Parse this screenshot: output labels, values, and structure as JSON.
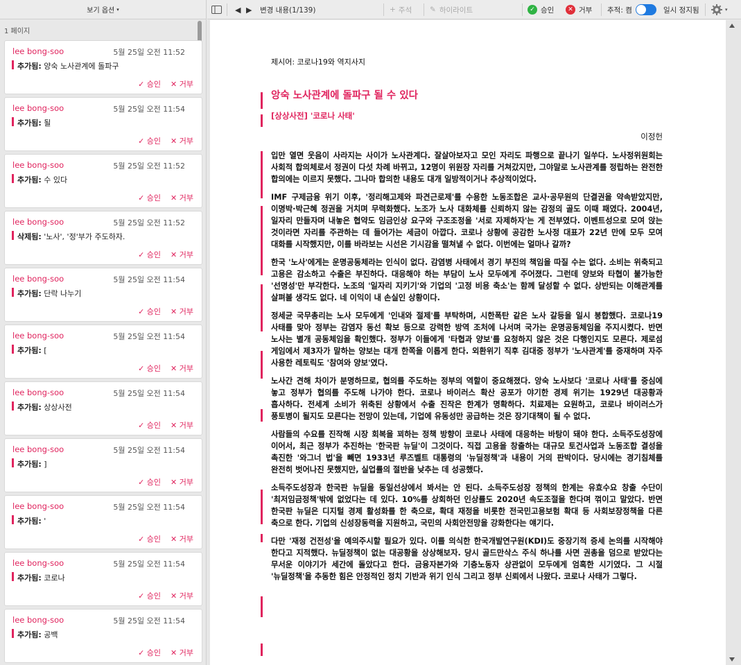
{
  "sidebar": {
    "view_options": "보기 옵션",
    "page_label": "1 페이지",
    "changes": [
      {
        "author": "lee bong-soo",
        "time": "5월 25일 오전 11:52",
        "type": "추가됨:",
        "text": "양숙 노사관계에 돌파구"
      },
      {
        "author": "lee bong-soo",
        "time": "5월 25일 오전 11:54",
        "type": "추가됨:",
        "text": "될"
      },
      {
        "author": "lee bong-soo",
        "time": "5월 25일 오전 11:52",
        "type": "추가됨:",
        "text": "수 있다"
      },
      {
        "author": "lee bong-soo",
        "time": "5월 25일 오전 11:52",
        "type": "삭제됨:",
        "text": "'노사', '정'부가 주도하자."
      },
      {
        "author": "lee bong-soo",
        "time": "5월 25일 오전 11:54",
        "type": "추가됨:",
        "text": "단락 나누기"
      },
      {
        "author": "lee bong-soo",
        "time": "5월 25일 오전 11:54",
        "type": "추가됨:",
        "text": "["
      },
      {
        "author": "lee bong-soo",
        "time": "5월 25일 오전 11:54",
        "type": "추가됨:",
        "text": "상상사전"
      },
      {
        "author": "lee bong-soo",
        "time": "5월 25일 오전 11:54",
        "type": "추가됨:",
        "text": "]"
      },
      {
        "author": "lee bong-soo",
        "time": "5월 25일 오전 11:54",
        "type": "추가됨:",
        "text": "'"
      },
      {
        "author": "lee bong-soo",
        "time": "5월 25일 오전 11:54",
        "type": "추가됨:",
        "text": "코로나"
      },
      {
        "author": "lee bong-soo",
        "time": "5월 25일 오전 11:54",
        "type": "추가됨:",
        "text": "공백"
      }
    ],
    "accept_label": "✓ 승인",
    "reject_label": "✕ 거부"
  },
  "toolbar": {
    "changes_count": "변경 내용(1/139)",
    "comment": "주석",
    "highlight": "하이라이트",
    "accept": "승인",
    "reject": "거부",
    "tracking": "추적: 켬",
    "pause": "일시 정지됨"
  },
  "document": {
    "meta": "제시어: 코로나19와 역지사지",
    "title": "앙숙 노사관계에 돌파구 될 수 있다",
    "subtitle": "[상상사전] '코로나 사태'",
    "author": "이정헌",
    "paragraphs": [
      "입만 열면 웃음이 사라지는 사이가 노사관계다. 잘살아보자고 모인 자리도 파행으로 끝나기 일쑤다. 노사정위원회는 사회적 합의체로서 정권이 다섯 차례 바뀌고, 12명이 위원장 자리를 거쳐갔지만, 그야말로 노사관계를 정립하는 완전한 합의에는 이르지 못했다. 그나마 합의한 내용도 대개 일방적이거나 추상적이었다.",
      "IMF 구제금융 위기 이후, '정리해고제와 파견근로제'를 수용한 노동조합은 교사·공무원의 단결권을 약속받았지만, 이명박·박근혜 정권을 거치며 무력화했다. 노조가 노사 대화체를 신뢰하지 않는 감정의 골도 이때 패였다. 2004년, 일자리 만들자며 내놓은 협약도 임금인상 요구와 구조조정을 '서로 자제하자'는 게 전부였다. 이벤트성으로 모여 앉는 것이라면 자리를 주관하는 데 들어가는 세금이 아깝다. 코로나 상황에 공감한 노사정 대표가 22년 만에 모두 모여 대화를 시작했지만, 이를 바라보는 시선은 기시감을 떨쳐낼 수 없다. 이번에는 얼마나 갈까?",
      "한국 '노사'에게는 운명공동체라는 인식이 없다. 감염병 사태에서 경기 부진의 책임을 따질 수는 없다. 소비는 위축되고 고용은 감소하고 수출은 부진하다. 대응해야 하는 부담이 노사 모두에게 주어졌다. 그런데 양보와 타협이 불가능한 '선명성'만 부각한다. 노조의 '일자리 지키기'와 기업의 '고정 비용 축소'는 함께 달성할 수 없다. 상반되는 이해관계를 살펴볼 생각도 없다. 네 이익이 내 손실인 상황이다.",
      "정세균 국무총리는 노사 모두에게 '인내와 절제'를 부탁하며, 시한폭탄 같은 노사 갈등을 일시 봉합했다. 코로나19 사태를 맞아 정부는 감염자 동선 확보 등으로 강력한 방역 조처에 나서며 국가는 운명공동체임을 주지시켰다. 반면 노사는 별개 공동체임을 확인했다. 정부가 이들에게 '타협과 양보'를 요청하지 않은 것은 다행인지도 모른다. 제로섬 게임에서 제3자가 말하는 양보는 대개 한쪽을 이롭게 한다. 외환위기 직후 김대중 정부가 '노사관계'를 중재하며 자주 사용한 레토릭도 '참여와 양보'였다.",
      "노사간 견해 차이가 분명하므로, 협의를 주도하는 정부의 역할이 중요해졌다. 앙숙 노사보다 '코로나 사태'를 중심에 놓고 정부가 협의를 주도해 나가야 한다. 코로나 바이러스 확산 공포가 야기한 경제 위기는 1929년 대공황과 흡사하다. 전세계 소비가 위축된 상황에서 수출 진작은 한계가 명확하다. 치료제는 요원하고, 코로나 바이러스가 풍토병이 될지도 모른다는 전망이 있는데, 기업에 유동성만 공급하는 것은 장기대책이 될 수 없다.",
      "사람들의 수요를 진작해 시장 회복을 꾀하는 정책 방향이 코로나 사태에 대응하는 바탕이 돼야 한다. 소득주도성장에 이어서, 최근 정부가 추진하는 '한국판 뉴딜'이 그것이다. 직접 고용을 창출하는 대규모 토건사업과 노동조합 결성을 촉진한 '와그너 법'을 빼면 1933년 루즈벨트 대통령의 '뉴딜정책'과 내용이 거의 판박이다. 당시에는 경기침체를 완전히 벗어나진 못했지만, 실업률의 절반을 낮추는 데 성공했다.",
      "소득주도성장과 한국판 뉴딜을 동일선상에서 봐서는 안 된다. 소득주도성장 정책의 한계는 유효수요 창출 수단이 '최저임금정책'밖에 없었다는 데 있다. 10%를 상회하던 인상률도 2020년 속도조절을 한다며 꺾이고 말았다. 반면 한국판 뉴딜은 디지털 경제 활성화를 한 축으로, 확대 재정을 비롯한 전국민고용보험 확대 등 사회보장정책을 다른 축으로 한다. 기업의 신성장동력을 지원하고, 국민의 사회안전망을 강화한다는 얘기다.",
      "다만 '재정 건전성'을 예의주시할 필요가 있다. 이를 의식한 한국개발연구원(KDI)도 중장기적 증세 논의를 시작해야 한다고 지적했다. 뉴딜정책이 없는 대공황을 상상해보자. 당시 골드만삭스 주식 하나를 사면 권총을 덤으로 받았다는 무서운 이야기가 세간에 돌았다고 한다. 금융자본가와 기층노동자 상관없이 모두에게 엄혹한 시기였다. 그 시절 '뉴딜정책'을 추동한 힘은 안정적인 정치 기반과 위기 인식 그리고 정부 신뢰에서 나왔다. 코로나 사태가 그렇다."
    ]
  },
  "colors": {
    "accent": "#e0245e",
    "toggle": "#1f7ae0",
    "accept": "#2fb344",
    "reject": "#e02f3a"
  }
}
